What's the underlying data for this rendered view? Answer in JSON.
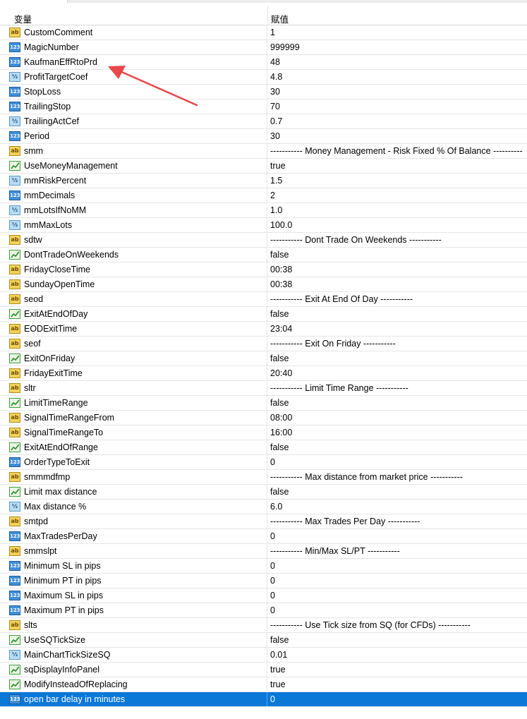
{
  "header": {
    "name_col": "变量",
    "value_col": "赋值"
  },
  "rows": [
    {
      "type": "str",
      "name": "CustomComment",
      "value": "1"
    },
    {
      "type": "int",
      "name": "MagicNumber",
      "value": "999999"
    },
    {
      "type": "int",
      "name": "KaufmanEffRtoPrd",
      "value": "48"
    },
    {
      "type": "dbl",
      "name": "ProfitTargetCoef",
      "value": "4.8"
    },
    {
      "type": "int",
      "name": "StopLoss",
      "value": "30"
    },
    {
      "type": "int",
      "name": "TrailingStop",
      "value": "70"
    },
    {
      "type": "dbl",
      "name": "TrailingActCef",
      "value": "0.7"
    },
    {
      "type": "int",
      "name": "Period",
      "value": "30"
    },
    {
      "type": "str",
      "name": "smm",
      "value": "----------- Money Management - Risk Fixed % Of Balance ----------"
    },
    {
      "type": "bool",
      "name": "UseMoneyManagement",
      "value": "true"
    },
    {
      "type": "dbl",
      "name": "mmRiskPercent",
      "value": "1.5"
    },
    {
      "type": "int",
      "name": "mmDecimals",
      "value": "2"
    },
    {
      "type": "dbl",
      "name": "mmLotsIfNoMM",
      "value": "1.0"
    },
    {
      "type": "dbl",
      "name": "mmMaxLots",
      "value": "100.0"
    },
    {
      "type": "str",
      "name": "sdtw",
      "value": "----------- Dont Trade On Weekends -----------"
    },
    {
      "type": "bool",
      "name": "DontTradeOnWeekends",
      "value": "false"
    },
    {
      "type": "str",
      "name": "FridayCloseTime",
      "value": "00:38"
    },
    {
      "type": "str",
      "name": "SundayOpenTime",
      "value": "00:38"
    },
    {
      "type": "str",
      "name": "seod",
      "value": "----------- Exit At End Of Day -----------"
    },
    {
      "type": "bool",
      "name": "ExitAtEndOfDay",
      "value": "false"
    },
    {
      "type": "str",
      "name": "EODExitTime",
      "value": "23:04"
    },
    {
      "type": "str",
      "name": "seof",
      "value": "----------- Exit On Friday -----------"
    },
    {
      "type": "bool",
      "name": "ExitOnFriday",
      "value": "false"
    },
    {
      "type": "str",
      "name": "FridayExitTime",
      "value": "20:40"
    },
    {
      "type": "str",
      "name": "sltr",
      "value": "----------- Limit Time Range -----------"
    },
    {
      "type": "bool",
      "name": "LimitTimeRange",
      "value": "false"
    },
    {
      "type": "str",
      "name": "SignalTimeRangeFrom",
      "value": "08:00"
    },
    {
      "type": "str",
      "name": "SignalTimeRangeTo",
      "value": "16:00"
    },
    {
      "type": "bool",
      "name": "ExitAtEndOfRange",
      "value": "false"
    },
    {
      "type": "int",
      "name": "OrderTypeToExit",
      "value": "0"
    },
    {
      "type": "str",
      "name": "smmmdfmp",
      "value": "----------- Max distance from market price -----------"
    },
    {
      "type": "bool",
      "name": "Limit max distance",
      "value": "false"
    },
    {
      "type": "dbl",
      "name": "Max distance %",
      "value": "6.0"
    },
    {
      "type": "str",
      "name": "smtpd",
      "value": "----------- Max Trades Per Day -----------"
    },
    {
      "type": "int",
      "name": "MaxTradesPerDay",
      "value": "0"
    },
    {
      "type": "str",
      "name": "smmslpt",
      "value": "----------- Min/Max SL/PT -----------"
    },
    {
      "type": "int",
      "name": "Minimum SL in pips",
      "value": "0"
    },
    {
      "type": "int",
      "name": "Minimum PT in pips",
      "value": "0"
    },
    {
      "type": "int",
      "name": "Maximum SL in pips",
      "value": "0"
    },
    {
      "type": "int",
      "name": "Maximum PT in pips",
      "value": "0"
    },
    {
      "type": "str",
      "name": "slts",
      "value": "----------- Use Tick size from SQ (for CFDs) -----------"
    },
    {
      "type": "bool",
      "name": "UseSQTickSize",
      "value": "false"
    },
    {
      "type": "dbl",
      "name": "MainChartTickSizeSQ",
      "value": "0.01"
    },
    {
      "type": "bool",
      "name": "sqDisplayInfoPanel",
      "value": "true"
    },
    {
      "type": "bool",
      "name": "ModifyInsteadOfReplacing",
      "value": "true"
    },
    {
      "type": "int",
      "name": "open bar delay in minutes",
      "value": "0",
      "selected": true
    }
  ],
  "icons": {
    "str": "string-type-icon",
    "int": "integer-type-icon",
    "dbl": "double-type-icon",
    "bool": "boolean-type-icon"
  },
  "icon_glyphs": {
    "str": "ab",
    "int": "123",
    "dbl": "½"
  },
  "colors": {
    "selection": "#0a78d7",
    "annotation_arrow": "#e8474c"
  }
}
